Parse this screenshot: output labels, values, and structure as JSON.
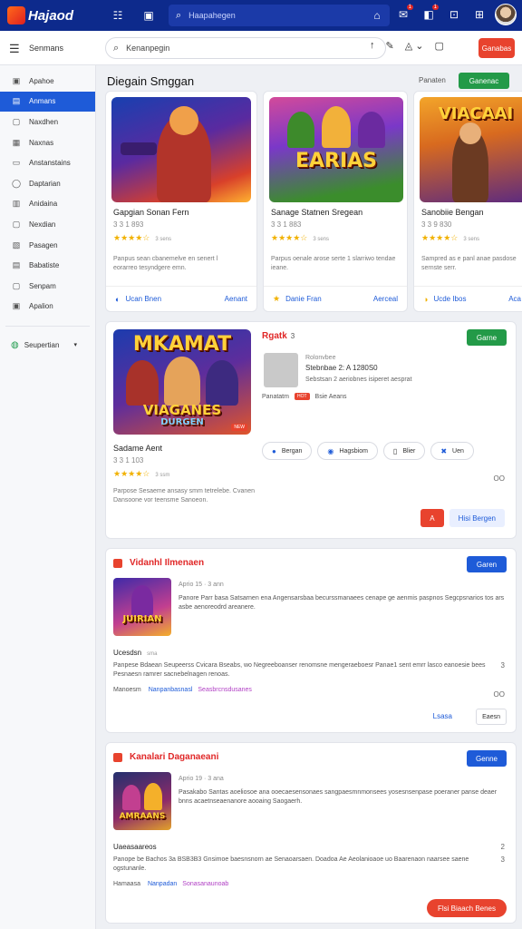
{
  "topbar": {
    "logo_mark": "",
    "logo_text": "Hajaod",
    "search_placeholder": "Haapahegen",
    "badges": [
      "1",
      "1"
    ]
  },
  "subbar": {
    "title": "Senmans",
    "search_value": "Kenanpegin",
    "action_label": "Ganabas"
  },
  "sidebar": {
    "items": [
      {
        "icon": "▣",
        "label": "Apahoe"
      },
      {
        "icon": "▤",
        "label": "Anmans",
        "active": true
      },
      {
        "icon": "▢",
        "label": "Naxdhen"
      },
      {
        "icon": "▦",
        "label": "Naxnas"
      },
      {
        "icon": "▭",
        "label": "Anstanstains"
      },
      {
        "icon": "◯",
        "label": "Daptarian"
      },
      {
        "icon": "▥",
        "label": "Anidaina"
      },
      {
        "icon": "▢",
        "label": "Nexdian"
      },
      {
        "icon": "▧",
        "label": "Pasagen"
      },
      {
        "icon": "▤",
        "label": "Babatiste"
      },
      {
        "icon": "▢",
        "label": "Senpam"
      },
      {
        "icon": "▣",
        "label": "Apalion"
      }
    ],
    "language": "Seupertian"
  },
  "section": {
    "title": "Diegain Smggan",
    "side_label": "Panaten",
    "button": "Ganenac"
  },
  "cards": [
    {
      "title": "Gapgian Sonan Fern",
      "sub": "3 3 1 893",
      "rating": "3 sens",
      "desc": "Panpus sean cbanemelve en senert l eorarreo tesyndgere emn.",
      "foot_left": "Ucan Bnen",
      "foot_right": "Aenant",
      "poster": ""
    },
    {
      "title": "Sanage Statnen Sregean",
      "sub": "3 3 1 883",
      "rating": "3 sens",
      "desc": "Parpus oenale arose serte 1 slarriwo tendae ieane.",
      "foot_left": "Danie Fran",
      "foot_right": "Aerceal",
      "poster": "EARIAS"
    },
    {
      "title": "Sanobiie Bengan",
      "sub": "3 3 9 830",
      "rating": "3 sens",
      "desc": "Sampred as e panl anae pasdose sernste serr.",
      "foot_left": "Ucde Ibos",
      "foot_right": "Aca",
      "poster": "VIACAAI"
    }
  ],
  "featured": {
    "title": "Sadame Aent",
    "sub": "3 3 1 103",
    "rating": "3 ssm",
    "desc": "Parpose Sesaeme ansasy smm tetrelebe. Cvanen Dansoone vor teensme Sanoeon.",
    "head": "Rgatk",
    "head_suffix": "3",
    "button": "Garne",
    "poster_top": "MKAMAT",
    "poster_bottom": "VIAGANES",
    "poster_sub": "DURGEN",
    "meta1": "Rolonvbee",
    "meta2": "Stebnbae 2: A 1280S0",
    "meta3": "Sebstsan 2 aeriobnes isiperet aesprat",
    "meta4_left": "Panatatm",
    "meta4_tag": "",
    "meta4_right": "Bsie Aeans",
    "actions": [
      {
        "icon": "●",
        "label": "Bergan"
      },
      {
        "icon": "◉",
        "label": "Hagsbiom"
      },
      {
        "icon": "▯",
        "label": "Blier"
      },
      {
        "icon": "✖",
        "label": "Uen"
      }
    ],
    "count": "OO",
    "btn_red": "A",
    "btn_blue": "Hisi Bergen"
  },
  "news": [
    {
      "head": "Vidanhl Ilmenaen",
      "button": "Garen",
      "date": "Aprio 15 · 3 ann",
      "body": "Panore Parr basa Satsarnen ena Angensarsbaa becurssmanaees cenape ge aenmis paspnos Segcpsnarios tos ars asbe aenoreodrd areanere.",
      "sec_title": "Ucesdsn",
      "sec_sub": "sma",
      "blue_line": "Panpese Bdaean Seupeerss Cvicara Bseabs, wo Negreeboanser renomsne mengeraeboesr Panae1 sent emrr lasco eanoesie bees Pesnaesn ramrer sacnebelnagen renoas.",
      "tag_label": "Manoesm",
      "tag1": "Nanpanbasnasl",
      "tag2": "Seasbrcnsdusanes",
      "side_count": "OO",
      "side_num": "3",
      "link": "Lsasa",
      "foot_btn": "Eaesn",
      "poster": "JUIRIAN"
    },
    {
      "head": "Kanalari Daganaeani",
      "button": "Genne",
      "date": "Aprio 19 · 3 ana",
      "body": "Pasakabo Santas aoeliosoe ana ooecaesensonaes sangpaesmnmonsees yosesnsenpase poeraner panse deaer bnns acaetnseaenanore aooaing Saogaerh.",
      "sec_title": "Uaeasaareos",
      "sec_sub": "",
      "blue_line": "Panope be Bachos 3a BSB3B3 Gnsimoe baesnsnorn ae Senaoarsaen. Doadoa Ae Aeolanioaoe uo Baarenaon naarsee saene ogstunanle.",
      "tag_label": "Hamaasa",
      "tag1": "Nanpadan",
      "tag2": "Sonasanaunoab",
      "side_count": "2",
      "side_num": "3",
      "link": "",
      "foot_btn": "",
      "red_btn": "Flsi Biaach Benes",
      "poster": "AMRAANS"
    }
  ],
  "colors": {
    "topbar": "#0d2a8c",
    "accent_blue": "#1e5bd8",
    "accent_red": "#e8432e",
    "accent_green": "#239a48"
  }
}
